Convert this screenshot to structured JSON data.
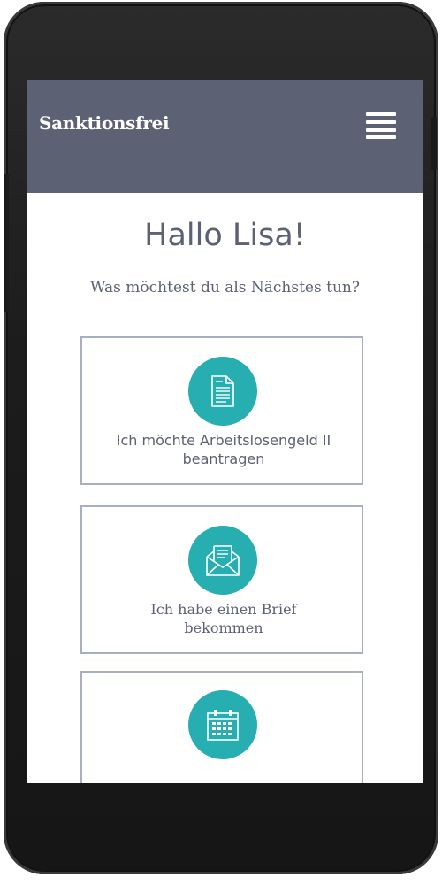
{
  "header": {
    "brand": "Sanktionsfrei"
  },
  "main": {
    "greeting": "Hallo Lisa!",
    "question": "Was möchtest du als Nächstes tun?",
    "cards": [
      {
        "line1": "Ich möchte Arbeitslosengeld II",
        "line2": "beantragen",
        "icon": "document-icon"
      },
      {
        "line1": "Ich habe einen Brief",
        "line2": "bekommen",
        "icon": "envelope-icon"
      },
      {
        "line1": "",
        "line2": "",
        "icon": "calendar-icon"
      }
    ]
  },
  "colors": {
    "header_bg": "#5c6174",
    "accent": "#26aeb0",
    "card_border": "#a7b0c0",
    "text": "#5c6174"
  }
}
